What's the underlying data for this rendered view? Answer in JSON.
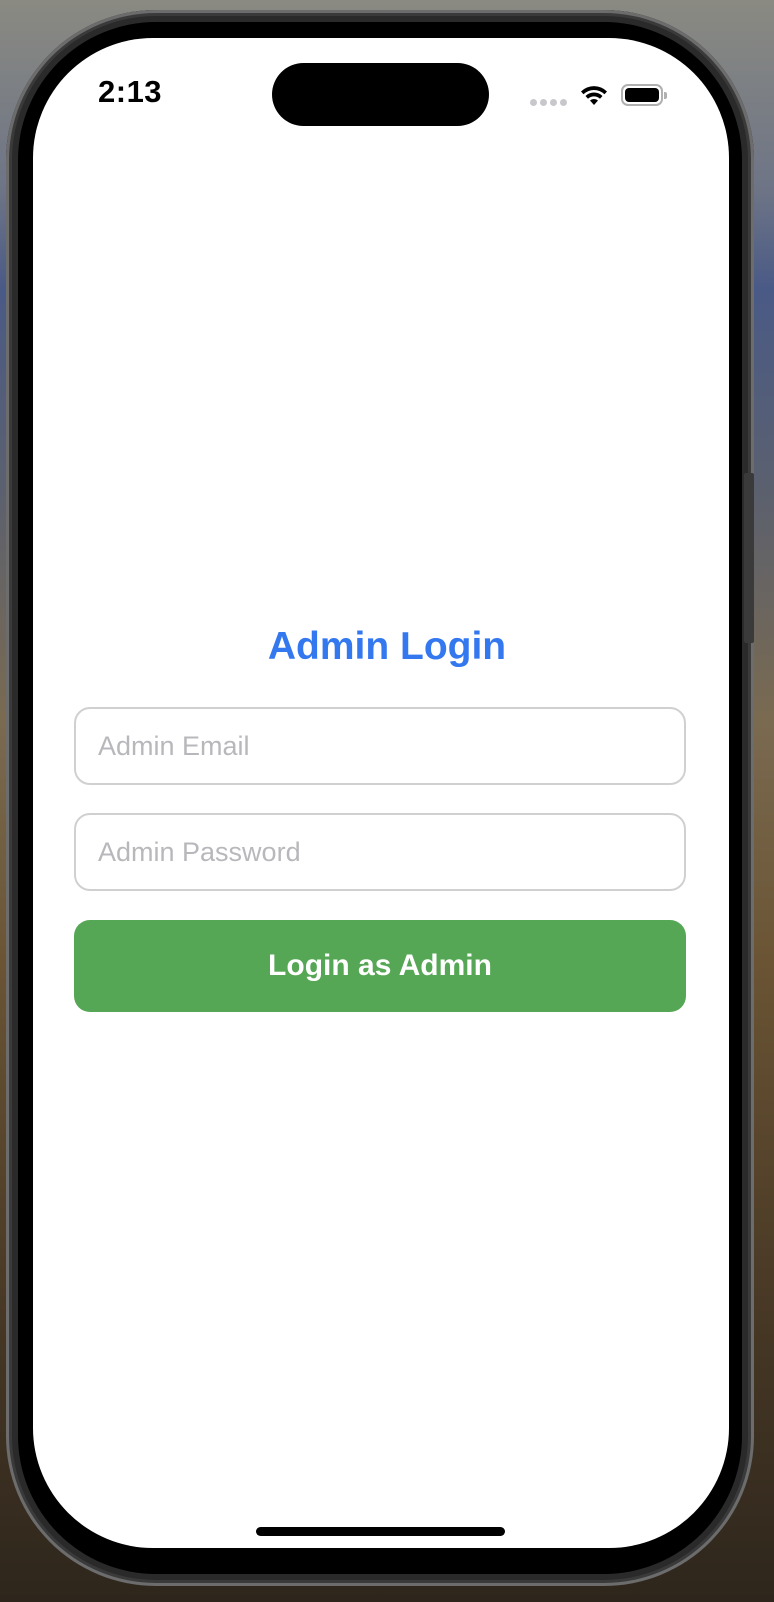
{
  "status_bar": {
    "time": "2:13"
  },
  "login": {
    "title": "Admin Login",
    "email_placeholder": "Admin Email",
    "email_value": "",
    "password_placeholder": "Admin Password",
    "password_value": "",
    "submit_label": "Login as Admin"
  },
  "colors": {
    "title": "#3478f0",
    "button": "#55a755",
    "field_border": "#d0d0d0",
    "placeholder": "#b8b8bc"
  },
  "icons": [
    "signal-dots-icon",
    "wifi-icon",
    "battery-icon"
  ]
}
